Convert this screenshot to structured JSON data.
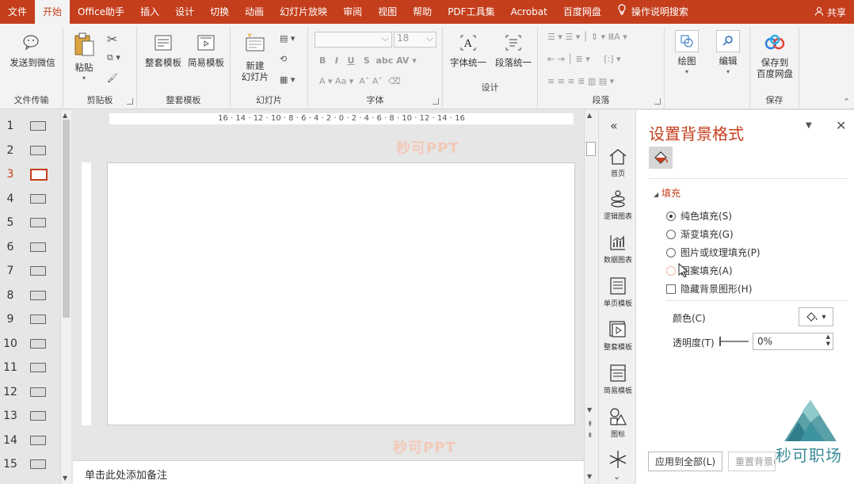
{
  "tabs": [
    "文件",
    "开始",
    "Office助手",
    "插入",
    "设计",
    "切换",
    "动画",
    "幻灯片放映",
    "审阅",
    "视图",
    "帮助",
    "PDF工具集",
    "Acrobat",
    "百度网盘"
  ],
  "active_tab": "开始",
  "tell_me": "操作说明搜索",
  "share": "共享",
  "ribbon": {
    "send_wechat": "发送到微信",
    "group_file": "文件传输",
    "paste": "粘贴",
    "group_clipboard": "剪贴板",
    "whole_template": "整套模板",
    "simple_template": "简易模板",
    "group_template": "整套模板",
    "new_slide": "新建\n幻灯片",
    "group_slides": "幻灯片",
    "font_size": "18",
    "group_font": "字体",
    "font_unify": "字体统一",
    "para_unify": "段落统一",
    "group_design": "设计",
    "group_paragraph": "段落",
    "drawing": "绘图",
    "editing": "编辑",
    "save_to": "保存到\n百度网盘",
    "group_save": "保存"
  },
  "slides": [
    {
      "num": "1"
    },
    {
      "num": "2"
    },
    {
      "num": "3",
      "selected": true
    },
    {
      "num": "4"
    },
    {
      "num": "5"
    },
    {
      "num": "6"
    },
    {
      "num": "7"
    },
    {
      "num": "8"
    },
    {
      "num": "9"
    },
    {
      "num": "10"
    },
    {
      "num": "11"
    },
    {
      "num": "12"
    },
    {
      "num": "13"
    },
    {
      "num": "14"
    },
    {
      "num": "15"
    }
  ],
  "ruler_labels": "16 · 14 · 12 · 10 · 8 · 6 · 4 · 2 · 0 · 2 · 4 · 6 · 8 · 10 · 12 · 14 · 16",
  "watermark": "秒可PPT",
  "notes_placeholder": "单击此处添加备注",
  "strip": [
    "首页",
    "逻辑图表",
    "数据图表",
    "单页模板",
    "整套模板",
    "简易模板",
    "图标"
  ],
  "pane": {
    "title": "设置背景格式",
    "section": "填充",
    "options": [
      "纯色填充(S)",
      "渐变填充(G)",
      "图片或纹理填充(P)",
      "图案填充(A)"
    ],
    "selected_option": 0,
    "hide_graphics": "隐藏背景图形(H)",
    "color_label": "颜色(C)",
    "transparency_label": "透明度(T)",
    "transparency_value": "0%",
    "apply_all": "应用到全部(L)",
    "reset": "重置背景(B)"
  },
  "logo_text": "秒可职场",
  "colors": {
    "accent": "#c43e1c",
    "ribbon_bg": "#f3f3f3",
    "workspace": "#e6e6e6"
  }
}
